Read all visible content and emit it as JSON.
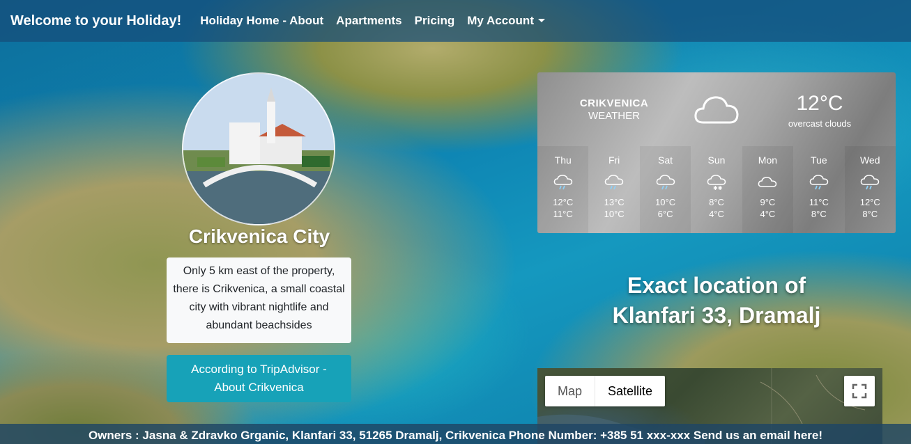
{
  "navbar": {
    "brand": "Welcome to your Holiday!",
    "links": [
      "Holiday Home - About",
      "Apartments",
      "Pricing",
      "My Account"
    ]
  },
  "city": {
    "title": "Crikvenica City",
    "description": "Only 5 km east of the property, there is Crikvenica, a small coastal city with vibrant nightlife and abundant beachsides",
    "button": "According to TripAdvisor - About Crikvenica"
  },
  "weather": {
    "city": "CRIKVENICA",
    "label": "WEATHER",
    "icon": "cloud-icon",
    "temp": "12°C",
    "condition": "overcast clouds",
    "forecast": [
      {
        "day": "Thu",
        "icon": "rain-cloud-icon",
        "hi": "12°C",
        "lo": "11°C"
      },
      {
        "day": "Fri",
        "icon": "rain-cloud-icon",
        "hi": "13°C",
        "lo": "10°C"
      },
      {
        "day": "Sat",
        "icon": "rain-cloud-icon",
        "hi": "10°C",
        "lo": "6°C"
      },
      {
        "day": "Sun",
        "icon": "snow-cloud-icon",
        "hi": "8°C",
        "lo": "4°C"
      },
      {
        "day": "Mon",
        "icon": "cloud-icon",
        "hi": "9°C",
        "lo": "4°C"
      },
      {
        "day": "Tue",
        "icon": "rain-cloud-icon",
        "hi": "11°C",
        "lo": "8°C"
      },
      {
        "day": "Wed",
        "icon": "rain-cloud-icon",
        "hi": "12°C",
        "lo": "8°C"
      }
    ]
  },
  "location": {
    "heading_line1": "Exact location of",
    "heading_line2": "Klanfari 33, Dramalj"
  },
  "map": {
    "map_label": "Map",
    "satellite_label": "Satellite",
    "active": "Satellite"
  },
  "footer": {
    "owners": "Owners : Jasna & Zdravko Grganic, Klanfari 33, 51265 Dramalj, Crikvenica",
    "phone": "Phone Number: +385 51 xxx-xxx",
    "email_link": "Send us an email here!"
  },
  "colors": {
    "button": "#17a2b8",
    "navbar": "#164c78"
  }
}
